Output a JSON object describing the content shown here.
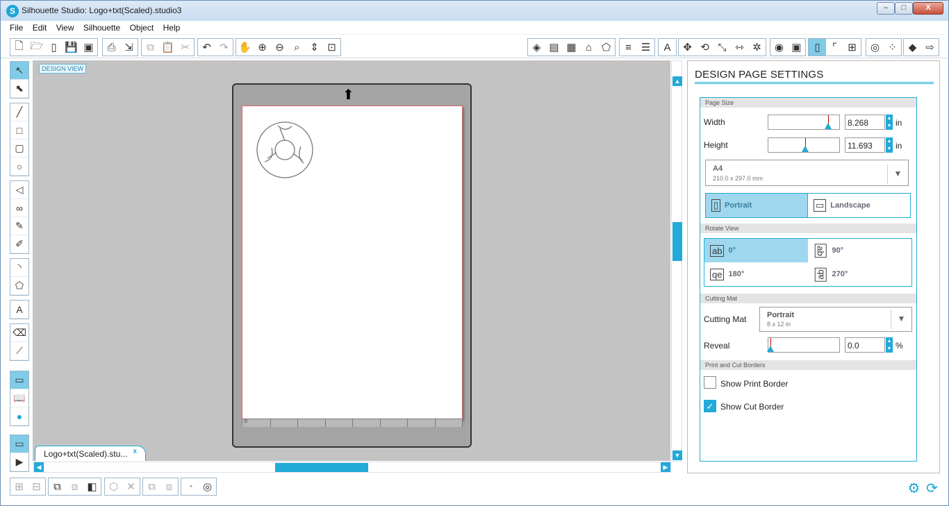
{
  "window": {
    "title": "Silhouette Studio: Logo+txt(Scaled).studio3",
    "min": "–",
    "max": "□",
    "close": "X"
  },
  "menu": [
    "File",
    "Edit",
    "View",
    "Silhouette",
    "Object",
    "Help"
  ],
  "canvas": {
    "design_view_label": "DESIGN VIEW",
    "ruler_start": "0"
  },
  "document_tab": {
    "label": "Logo+txt(Scaled).stu...",
    "close": "x"
  },
  "panel": {
    "title": "DESIGN PAGE SETTINGS",
    "page_size": {
      "section": "Page Size",
      "width_label": "Width",
      "width_value": "8.268",
      "height_label": "Height",
      "height_value": "11.693",
      "unit": "in",
      "preset_name": "A4",
      "preset_dims": "210.0 x 297.0 mm",
      "orientation": {
        "portrait": "Portrait",
        "landscape": "Landscape",
        "selected": "Portrait"
      }
    },
    "rotate_view": {
      "section": "Rotate View",
      "options": [
        "0°",
        "90°",
        "180°",
        "270°"
      ],
      "selected": "0°",
      "icon_text": [
        "ab",
        "ab",
        "qe",
        "ab"
      ]
    },
    "cutting_mat": {
      "section": "Cutting Mat",
      "label": "Cutting Mat",
      "value": "Portrait",
      "value_sub": "8 x 12 in",
      "reveal_label": "Reveal",
      "reveal_value": "0.0",
      "reveal_unit": "%"
    },
    "borders": {
      "section": "Print and Cut Borders",
      "show_print_border": "Show Print Border",
      "show_cut_border": "Show Cut Border",
      "print_checked": false,
      "cut_checked": true
    }
  },
  "colors": {
    "accent": "#22aad8",
    "canvas_bg": "#c3c3c3",
    "mat": "#a4a4a4"
  }
}
